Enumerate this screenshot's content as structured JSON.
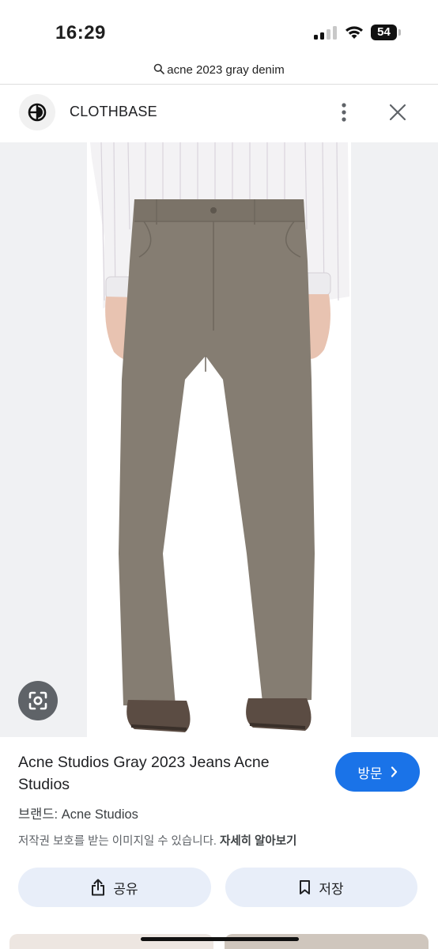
{
  "status_bar": {
    "time": "16:29",
    "battery": "54"
  },
  "url_bar": {
    "text": "acne 2023 gray denim"
  },
  "header": {
    "site_name": "CLOTHBASE"
  },
  "result": {
    "title": "Acne Studios Gray 2023 Jeans Acne Studios",
    "visit_label": "방문",
    "brand": "브랜드: Acne Studios",
    "copyright_text": "저작권 보호를 받는 이미지일 수 있습니다.",
    "learn_more": "자세히 알아보기",
    "share_label": "공유",
    "save_label": "저장"
  },
  "colors": {
    "accent": "#1a73e8",
    "pill_bg": "#e8eef9",
    "jeans": "#857d72"
  },
  "icons": [
    "search-icon",
    "clothbase-logo-icon",
    "more-vert-icon",
    "close-icon",
    "google-lens-icon",
    "share-icon",
    "bookmark-icon",
    "chevron-right-icon"
  ]
}
